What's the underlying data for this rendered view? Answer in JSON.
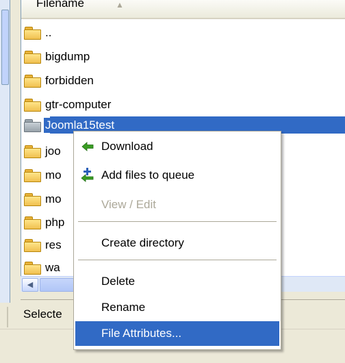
{
  "file_list": {
    "column_header": "Filename",
    "rows": [
      {
        "label": ".."
      },
      {
        "label": "bigdump"
      },
      {
        "label": "forbidden"
      },
      {
        "label": "gtr-computer"
      },
      {
        "label": "Joomla15test"
      },
      {
        "label": "joo"
      },
      {
        "label": "mo"
      },
      {
        "label": "mo"
      },
      {
        "label": "php"
      },
      {
        "label": "res"
      },
      {
        "label": "wa"
      }
    ]
  },
  "status": {
    "text": "Selecte"
  },
  "context_menu": {
    "items": {
      "download": "Download",
      "add_to_queue": "Add files to queue",
      "view_edit": "View / Edit",
      "create_directory": "Create directory",
      "delete": "Delete",
      "rename": "Rename",
      "file_attributes": "File Attributes..."
    }
  },
  "icons": {
    "folder": "folder-icon",
    "download": "download-arrow-icon",
    "queue": "add-to-queue-icon"
  },
  "colors": {
    "selection": "#316ac5",
    "menu_icon_green": "#3a9d23",
    "folder_yellow": "#f0c050"
  }
}
